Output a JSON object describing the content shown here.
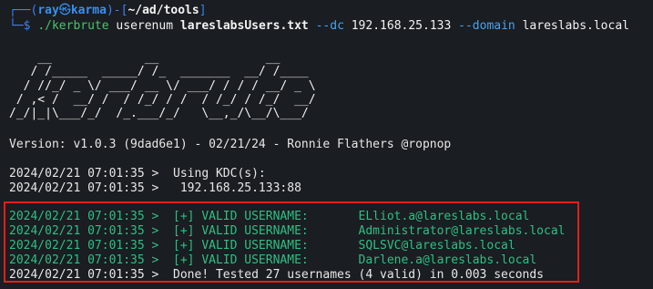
{
  "prompt": {
    "open": "┌──(",
    "user": "ray",
    "skull": "㉿",
    "host": "karma",
    "close_bracket": ")-[",
    "path": "~/ad/tools",
    "end_bracket": "]",
    "arrow": "└─$",
    "cmd": "./kerbrute",
    "subcmd": "userenum",
    "file": "lareslabsUsers.txt",
    "opt_dc": "--dc",
    "dc_ip": "192.168.25.133",
    "opt_domain": "--domain",
    "domain": "lareslabs.local"
  },
  "banner": {
    "ascii_art": "    __             __               __     \n   / /_____  _____/ /_  _______  __/ /____ \n  / //_/ _ \\/ ___/ __ \\/ ___/ / / / __/ _ \\\n / ,< /  __/ /  / /_/ / /  / /_/ / /_/  __/\n/_/|_|\\___/_/  /_.___/_/   \\__,_/\\__/\\___/ ",
    "version_line": "Version: v1.0.3 (9dad6e1) - 02/21/24 - Ronnie Flathers @ropnop"
  },
  "log": {
    "kdc_line": "2024/02/21 07:01:35 >  Using KDC(s):",
    "kdc_addr_line": "2024/02/21 07:01:35 >   192.168.25.133:88",
    "valid_lines": [
      "2024/02/21 07:01:35 >  [+] VALID USERNAME:       ELliot.a@lareslabs.local",
      "2024/02/21 07:01:35 >  [+] VALID USERNAME:       Administrator@lareslabs.local",
      "2024/02/21 07:01:35 >  [+] VALID USERNAME:       SQLSVC@lareslabs.local",
      "2024/02/21 07:01:35 >  [+] VALID USERNAME:       Darlene.a@lareslabs.local"
    ],
    "done_line": "2024/02/21 07:01:35 >  Done! Tested 27 usernames (4 valid) in 0.003 seconds"
  },
  "colors": {
    "background": "#1a1d21",
    "prompt_blue": "#3b82f6",
    "valid_green": "#2fbf84",
    "highlight_red": "#e0201b"
  }
}
